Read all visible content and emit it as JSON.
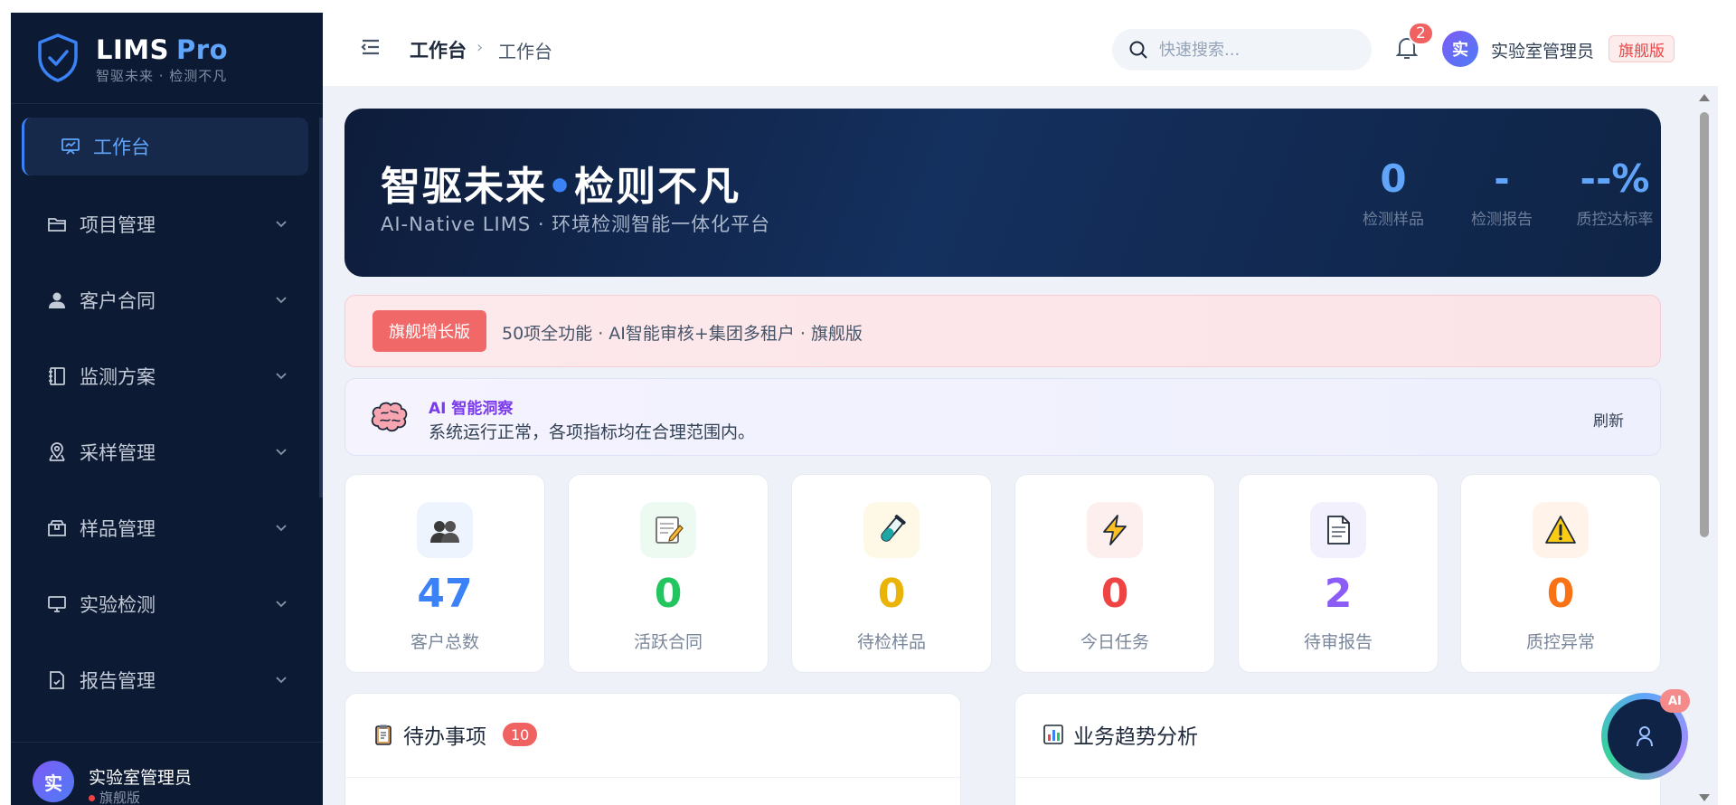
{
  "brand": {
    "name": "LIMS",
    "name_suffix": "Pro",
    "slogan": "智驱未来 · 检测不凡"
  },
  "sidebar": {
    "items": [
      {
        "label": "工作台",
        "icon": "presentation-icon",
        "active": true
      },
      {
        "label": "项目管理",
        "icon": "folder-icon"
      },
      {
        "label": "客户合同",
        "icon": "user-icon"
      },
      {
        "label": "监测方案",
        "icon": "notebook-icon"
      },
      {
        "label": "采样管理",
        "icon": "location-pin-icon"
      },
      {
        "label": "样品管理",
        "icon": "package-icon"
      },
      {
        "label": "实验检测",
        "icon": "monitor-icon"
      },
      {
        "label": "报告管理",
        "icon": "document-check-icon"
      }
    ],
    "footer": {
      "avatar": "实",
      "name": "实验室管理员",
      "tag": "旗舰版"
    }
  },
  "header": {
    "breadcrumb_main": "工作台",
    "breadcrumb_sep": "›",
    "breadcrumb_current": "工作台",
    "search_placeholder": "快速搜索...",
    "notification_count": "2",
    "avatar": "实",
    "user_name": "实验室管理员",
    "user_tag": "旗舰版"
  },
  "hero": {
    "title_left": "智驱未来",
    "title_dot": "•",
    "title_right": "检则不凡",
    "subtitle": "AI-Native LIMS · 环境检测智能一体化平台",
    "stats": [
      {
        "value": "0",
        "label": "检测样品"
      },
      {
        "value": "-",
        "label": "检测报告"
      },
      {
        "value": "--%",
        "label": "质控达标率"
      }
    ]
  },
  "promo": {
    "tag": "旗舰增长版",
    "text": "50项全功能 · AI智能审核+集团多租户 · 旗舰版"
  },
  "ai_insight": {
    "title": "AI 智能洞察",
    "text": "系统运行正常，各项指标均在合理范围内。",
    "refresh_label": "刷新"
  },
  "stats": [
    {
      "value": "47",
      "label": "客户总数",
      "icon": "people-icon",
      "color": "#3b82f6",
      "bg": "#eef4fe"
    },
    {
      "value": "0",
      "label": "活跃合同",
      "icon": "memo-icon",
      "color": "#22c55e",
      "bg": "#ecfaf1"
    },
    {
      "value": "0",
      "label": "待检样品",
      "icon": "test-tube-icon",
      "color": "#eab308",
      "bg": "#fef9e6"
    },
    {
      "value": "0",
      "label": "今日任务",
      "icon": "lightning-icon",
      "color": "#ef4444",
      "bg": "#feefef"
    },
    {
      "value": "2",
      "label": "待审报告",
      "icon": "page-icon",
      "color": "#8b5cf6",
      "bg": "#f3f0fe"
    },
    {
      "value": "0",
      "label": "质控异常",
      "icon": "warning-icon",
      "color": "#f97316",
      "bg": "#fff3ea"
    }
  ],
  "panels": {
    "todo": {
      "title": "待办事项",
      "badge": "10",
      "icon": "clipboard-icon"
    },
    "trend": {
      "title": "业务趋势分析",
      "icon": "bar-chart-icon"
    }
  },
  "assistant": {
    "badge": "AI"
  },
  "colors": {
    "sidebar_bg": "#0c1a33",
    "accent": "#3b82f6",
    "danger": "#f06262",
    "ai_purple": "#7c3aed"
  }
}
